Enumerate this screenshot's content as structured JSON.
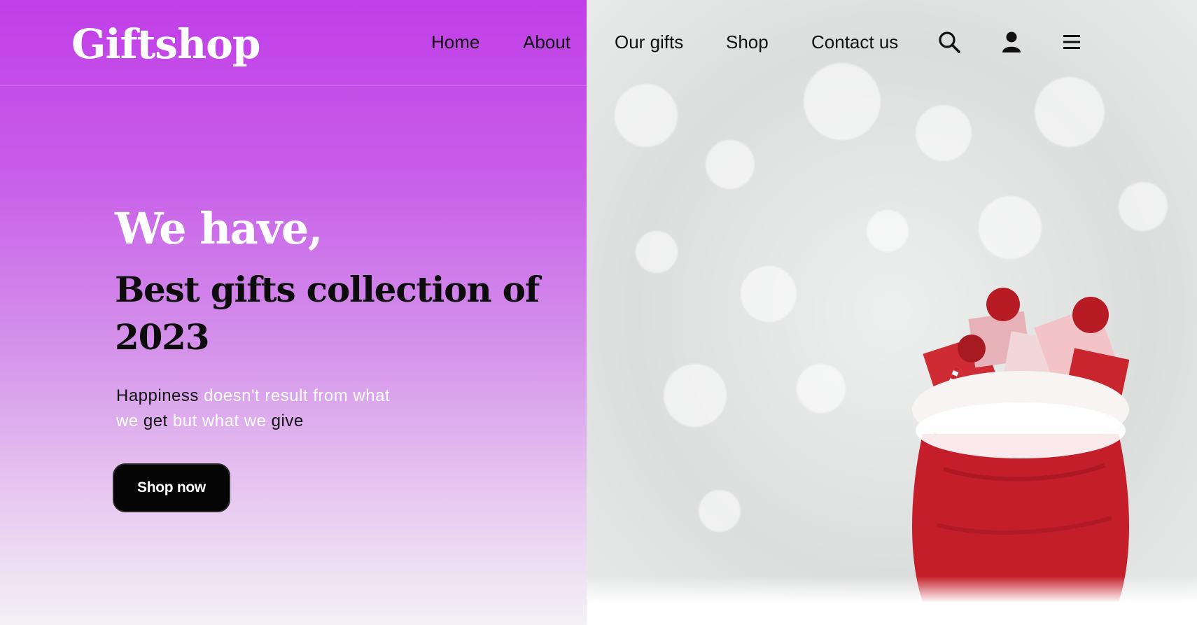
{
  "header": {
    "logo": "Giftshop",
    "nav": [
      "Home",
      "About",
      "Our gifts",
      "Shop",
      "Contact us"
    ],
    "icons": [
      "search-icon",
      "user-icon",
      "menu-icon"
    ]
  },
  "hero": {
    "kicker": "We have,",
    "title": "Best gifts collection of 2023",
    "quote": {
      "w1": "Happiness",
      "w2": " doesn't result from what we ",
      "w3": "get",
      "w4": " but what we ",
      "w5": "give"
    },
    "button": "Shop now"
  },
  "colors": {
    "accent": "#c13ee8",
    "button": "#050505",
    "text_dark": "#111111",
    "text_light": "#ffffff"
  }
}
